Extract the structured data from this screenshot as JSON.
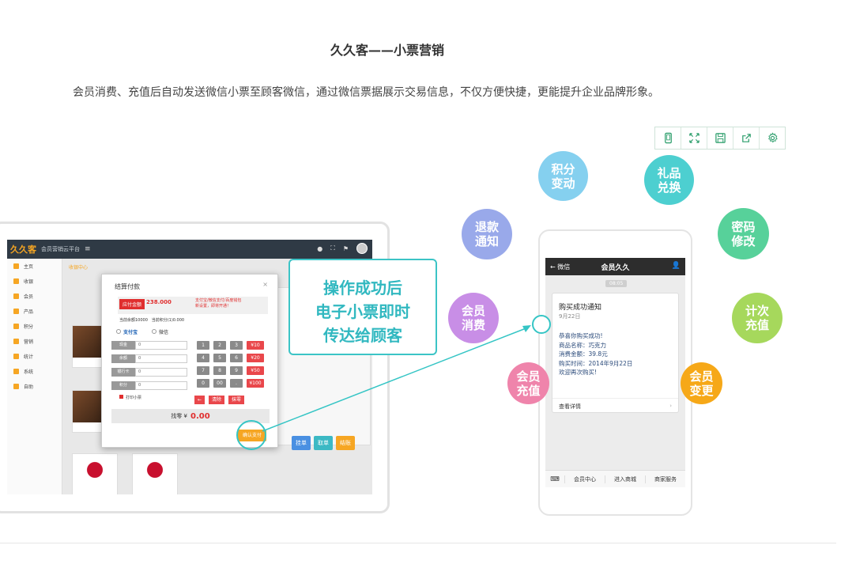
{
  "page": {
    "title": "久久客——小票营销",
    "description": "会员消费、充值后自动发送微信小票至顾客微信，通过微信票据展示交易信息，不仅方便快捷，更能提升企业品牌形象。"
  },
  "toolbar": {
    "icons": [
      "phone-icon",
      "fullscreen-icon",
      "save-icon",
      "share-icon",
      "settings-icon"
    ]
  },
  "app": {
    "logo": "久久客",
    "name": "会员营销云平台",
    "tab": "收银中心",
    "sidebar": [
      "主页",
      "收银",
      "会员",
      "产品",
      "积分",
      "营销",
      "统计",
      "系统",
      "自助"
    ]
  },
  "dialog": {
    "title": "结算付款",
    "close": "×",
    "amount_due_label": "应付金额",
    "amount_due": "238.000",
    "pay_note": "支付宝/微信支付/百度钱包\n新设置，即将开通！",
    "balance": "当前余额10000",
    "points": "当前积分(1)0.000",
    "pay_options": [
      "支付宝",
      "微信"
    ],
    "methods": [
      {
        "label": "现金",
        "value": "0"
      },
      {
        "label": "余额",
        "value": "0"
      },
      {
        "label": "银行卡",
        "value": "0"
      },
      {
        "label": "积分",
        "value": "0"
      }
    ],
    "keys": [
      "1",
      "2",
      "3",
      "¥10",
      "4",
      "5",
      "6",
      "¥20",
      "7",
      "8",
      "9",
      "¥50",
      "0",
      "00",
      ".",
      "¥100"
    ],
    "bottom_keys": [
      "←",
      "清除",
      "抹零"
    ],
    "print_receipt": "打印小票",
    "change_label": "找零 ¥",
    "change_value": "0.00",
    "confirm": "确认支付"
  },
  "cart_buttons": [
    "挂单",
    "取单",
    "结账"
  ],
  "callout": {
    "lines": [
      "操作成功后",
      "电子小票即时",
      "传达给顾客"
    ]
  },
  "phone": {
    "back": "微信",
    "title": "会员久久",
    "time": "08:05",
    "card_title": "购买成功通知",
    "card_date": "9月22日",
    "lines": [
      "恭喜你购买成功!",
      "商品名称：巧克力",
      "消费金额：39.8元",
      "购买时间：2014年9月22日",
      "欢迎再次购买!"
    ],
    "detail": "查看详情",
    "footer": [
      "会员中心",
      "进入商城",
      "商家服务"
    ]
  },
  "bubbles": [
    {
      "text1": "积分",
      "text2": "变动",
      "color": "#85d0ef"
    },
    {
      "text1": "礼品",
      "text2": "兑换",
      "color": "#4dcfd0"
    },
    {
      "text1": "退款",
      "text2": "通知",
      "color": "#99a9ea"
    },
    {
      "text1": "密码",
      "text2": "修改",
      "color": "#57d19a"
    },
    {
      "text1": "会员",
      "text2": "消费",
      "color": "#c88ee6"
    },
    {
      "text1": "计次",
      "text2": "充值",
      "color": "#a6d85c"
    },
    {
      "text1": "会员",
      "text2": "充值",
      "color": "#ef84ab"
    },
    {
      "text1": "会员",
      "text2": "变更",
      "color": "#f6a818"
    }
  ]
}
